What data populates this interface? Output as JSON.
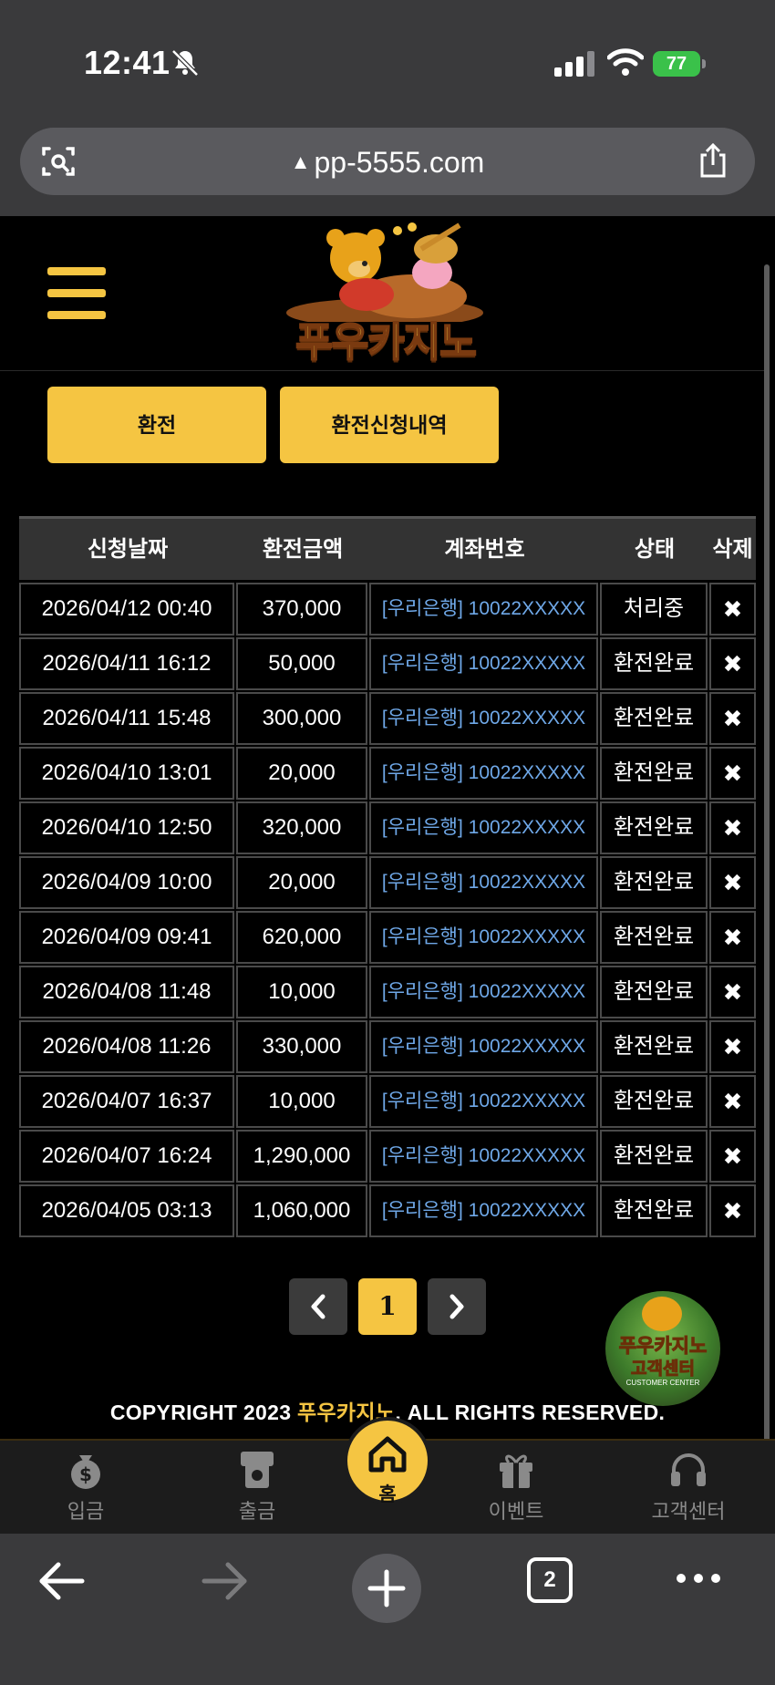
{
  "status_bar": {
    "time": "12:41",
    "battery_percent": "77"
  },
  "browser": {
    "url": "pp-5555.com",
    "tab_count": "2"
  },
  "site": {
    "logo_text": "푸우카지노"
  },
  "tabs": [
    {
      "label": "환전"
    },
    {
      "label": "환전신청내역"
    }
  ],
  "table": {
    "headers": [
      "신청날짜",
      "환전금액",
      "계좌번호",
      "상태",
      "삭제"
    ],
    "rows": [
      {
        "date": "2026/04/12 00:40",
        "amount": "370,000",
        "account": "[우리은행] 10022XXXXX",
        "status": "처리중",
        "delete": "✖"
      },
      {
        "date": "2026/04/11 16:12",
        "amount": "50,000",
        "account": "[우리은행] 10022XXXXX",
        "status": "환전완료",
        "delete": "✖"
      },
      {
        "date": "2026/04/11 15:48",
        "amount": "300,000",
        "account": "[우리은행] 10022XXXXX",
        "status": "환전완료",
        "delete": "✖"
      },
      {
        "date": "2026/04/10 13:01",
        "amount": "20,000",
        "account": "[우리은행] 10022XXXXX",
        "status": "환전완료",
        "delete": "✖"
      },
      {
        "date": "2026/04/10 12:50",
        "amount": "320,000",
        "account": "[우리은행] 10022XXXXX",
        "status": "환전완료",
        "delete": "✖"
      },
      {
        "date": "2026/04/09 10:00",
        "amount": "20,000",
        "account": "[우리은행] 10022XXXXX",
        "status": "환전완료",
        "delete": "✖"
      },
      {
        "date": "2026/04/09 09:41",
        "amount": "620,000",
        "account": "[우리은행] 10022XXXXX",
        "status": "환전완료",
        "delete": "✖"
      },
      {
        "date": "2026/04/08 11:48",
        "amount": "10,000",
        "account": "[우리은행] 10022XXXXX",
        "status": "환전완료",
        "delete": "✖"
      },
      {
        "date": "2026/04/08 11:26",
        "amount": "330,000",
        "account": "[우리은행] 10022XXXXX",
        "status": "환전완료",
        "delete": "✖"
      },
      {
        "date": "2026/04/07 16:37",
        "amount": "10,000",
        "account": "[우리은행] 10022XXXXX",
        "status": "환전완료",
        "delete": "✖"
      },
      {
        "date": "2026/04/07 16:24",
        "amount": "1,290,000",
        "account": "[우리은행] 10022XXXXX",
        "status": "환전완료",
        "delete": "✖"
      },
      {
        "date": "2026/04/05 03:13",
        "amount": "1,060,000",
        "account": "[우리은행] 10022XXXXX",
        "status": "환전완료",
        "delete": "✖"
      }
    ]
  },
  "pagination": {
    "prev_icon": "chevron-left-icon",
    "current_page": "1",
    "next_icon": "chevron-right-icon"
  },
  "customer_center_badge": {
    "line1": "푸우카지노",
    "line2": "고객센터",
    "line3": "CUSTOMER CENTER"
  },
  "footer": {
    "copyright_prefix": "COPYRIGHT 2023 ",
    "copyright_brand": "푸우카지노",
    "copyright_suffix": ". ALL RIGHTS RESERVED."
  },
  "bottom_nav": {
    "items": [
      {
        "label": "입금",
        "icon": "money-bag-icon"
      },
      {
        "label": "출금",
        "icon": "atm-icon"
      },
      {
        "label": "홈",
        "icon": "home-icon"
      },
      {
        "label": "이벤트",
        "icon": "gift-icon"
      },
      {
        "label": "고객센터",
        "icon": "headphones-icon"
      }
    ]
  },
  "colors": {
    "accent": "#f5c542",
    "account_link": "#6fa8e8",
    "background": "#000000"
  }
}
